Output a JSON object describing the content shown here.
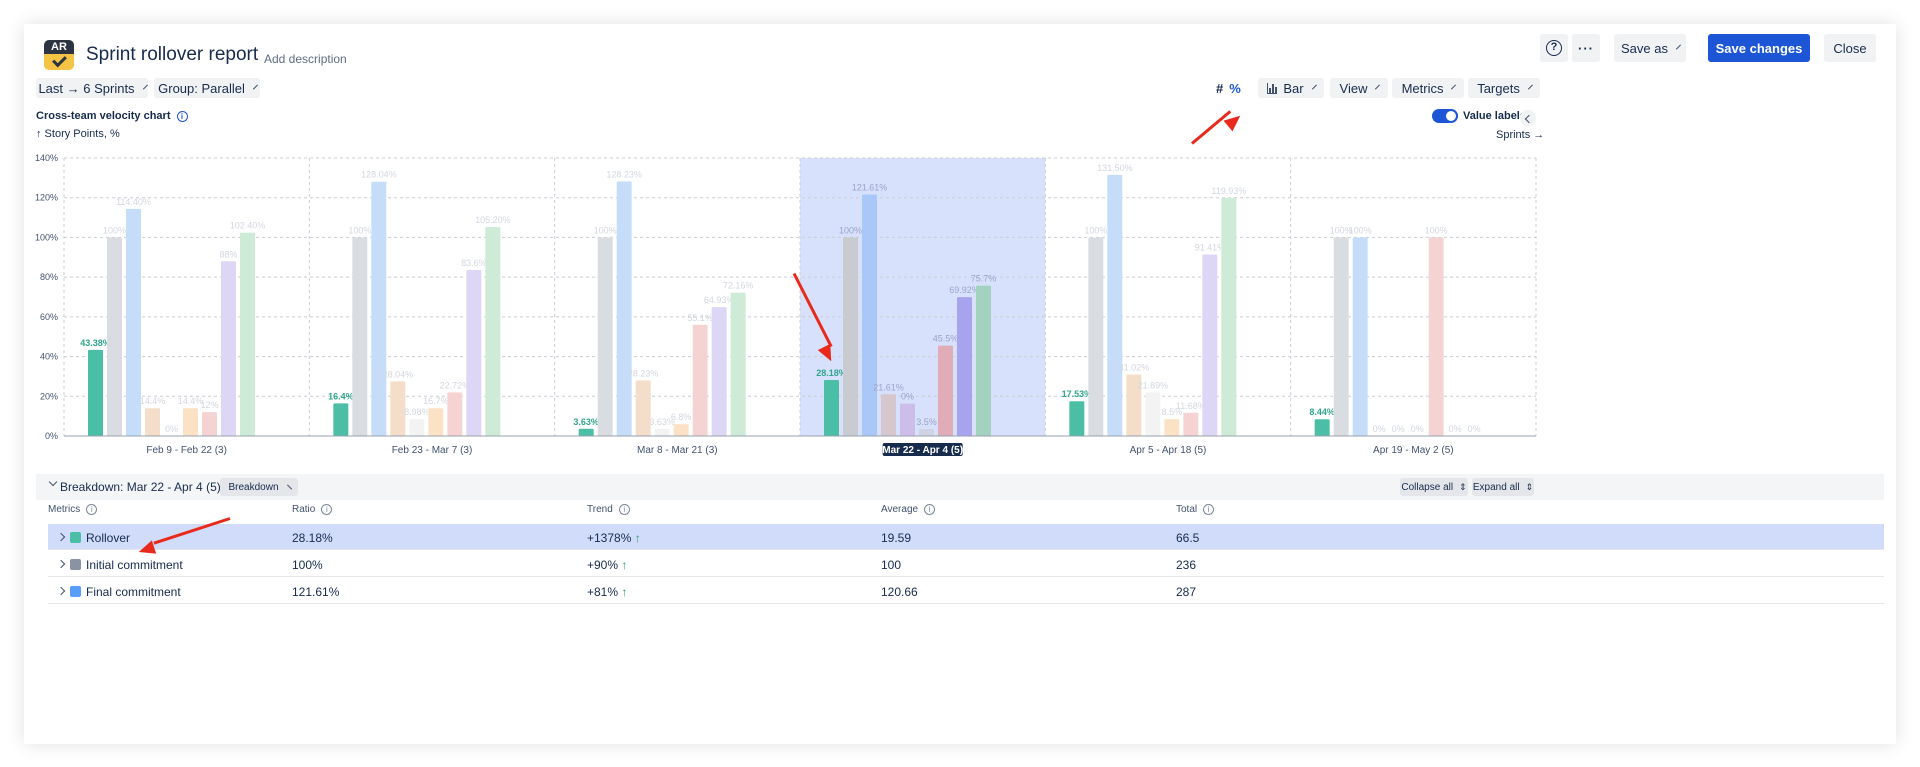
{
  "header": {
    "logo_text": "AR",
    "title": "Sprint rollover report",
    "add_description": "Add description",
    "help_icon": "question-circle-icon",
    "more_icon": "ellipsis-icon",
    "save_as": "Save as",
    "save_changes": "Save changes",
    "close": "Close"
  },
  "filters": {
    "sprints": "Last → 6 Sprints",
    "group": "Group: Parallel"
  },
  "toolbar": {
    "hash": "#",
    "percent": "%",
    "chart_type": "Bar",
    "view": "View",
    "metrics": "Metrics",
    "targets": "Targets"
  },
  "chart_header": {
    "title": "Cross-team velocity chart",
    "y_unit": "↑ Story Points, %",
    "value_labels": "Value labels",
    "x_unit": "Sprints →"
  },
  "colors": {
    "accent": "#1c56d6",
    "rollover": "#4bbfa5",
    "selected_band": "#d1dcfb"
  },
  "chart_data": {
    "type": "bar",
    "yticks": [
      "0%",
      "20%",
      "40%",
      "60%",
      "80%",
      "100%",
      "120%",
      "140%"
    ],
    "ylim": [
      0,
      140
    ],
    "selected_group": 3,
    "categories": [
      "Feb 9 - Feb 22 (3)",
      "Feb 23 - Mar 7 (3)",
      "Mar 8 - Mar 21 (3)",
      "Mar 22 - Apr 4 (5)",
      "Apr 5 - Apr 18 (5)",
      "Apr 19 - May 2 (5)"
    ],
    "series_colors": [
      "#4bbfa5",
      "#d9dde2",
      "#c6ddfa",
      "#f4ddc9",
      "#f3f3f3",
      "#fbe2c5",
      "#f6d3d3",
      "#ddd6f5",
      "#cdebd7"
    ],
    "series_colors_selected": [
      "#4bbfa5",
      "#c8cbd0",
      "#a9c8f7",
      "#d6c6cd",
      "#cdbde9",
      "#cfd3e3",
      "#e0acb8",
      "#a7a3ef",
      "#a3d3c0"
    ],
    "groups": [
      {
        "values": [
          43.38,
          100,
          114.4,
          14,
          0,
          14,
          12,
          88,
          102.4
        ],
        "labels": [
          "43.38%",
          "100%",
          "114.40%",
          "14.4%",
          "0%",
          "14.4%",
          "12%",
          "88%",
          "102.40%"
        ]
      },
      {
        "values": [
          16.4,
          100,
          128.04,
          27.5,
          8.5,
          14,
          22,
          83.6,
          105.2
        ],
        "labels": [
          "16.4%",
          "100%",
          "128.04%",
          "28.04%",
          "8.98%",
          "16.7%",
          "22.72%",
          "83.6%",
          "105.20%"
        ]
      },
      {
        "values": [
          3.63,
          100,
          128.23,
          28,
          3.6,
          6,
          56,
          64.9,
          72.16
        ],
        "labels": [
          "3.63%",
          "100%",
          "128.23%",
          "28.23%",
          "3.63%",
          "6.8%",
          "55.1%",
          "64.93%",
          "72.16%"
        ]
      },
      {
        "values": [
          28.18,
          100,
          121.61,
          21,
          16.3,
          3.5,
          45.5,
          69.92,
          75.7
        ],
        "labels": [
          "28.18%",
          "100%",
          "121.61%",
          "21.61%",
          "0%",
          "3.5%",
          "45.5%",
          "69.92%",
          "75.7%"
        ]
      },
      {
        "values": [
          17.53,
          100,
          131.5,
          31,
          22,
          8.5,
          11.68,
          91.41,
          119.93
        ],
        "labels": [
          "17.53%",
          "100%",
          "131.50%",
          "31.02%",
          "21.89%",
          "8.5%",
          "11.68%",
          "91.41%",
          "119.93%"
        ]
      },
      {
        "values": [
          8.44,
          100,
          100,
          0,
          0,
          0,
          100,
          0,
          0
        ],
        "labels": [
          "8.44%",
          "100%",
          "100%",
          "0%",
          "0%",
          "0%",
          "100%",
          "0%",
          "0%"
        ]
      }
    ]
  },
  "breakdown": {
    "title": "Breakdown: Mar 22 - Apr 4 (5)",
    "button": "Breakdown",
    "collapse_all": "Collapse all",
    "expand_all": "Expand all"
  },
  "table": {
    "headers": {
      "metrics": "Metrics",
      "ratio": "Ratio",
      "trend": "Trend",
      "average": "Average",
      "total": "Total"
    },
    "rows": [
      {
        "name": "Rollover",
        "color": "#4bbfa5",
        "ratio": "28.18%",
        "trend": "+1378%",
        "average": "19.59",
        "total": "66.5"
      },
      {
        "name": "Initial commitment",
        "color": "#8993a4",
        "ratio": "100%",
        "trend": "+90%",
        "average": "100",
        "total": "236"
      },
      {
        "name": "Final commitment",
        "color": "#579dff",
        "ratio": "121.61%",
        "trend": "+81%",
        "average": "120.66",
        "total": "287"
      }
    ]
  }
}
